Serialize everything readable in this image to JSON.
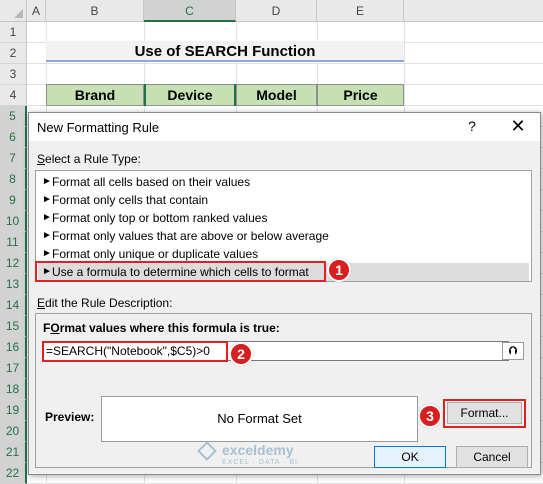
{
  "sheet": {
    "columns": [
      "A",
      "B",
      "C",
      "D",
      "E"
    ],
    "selected_column": "C",
    "rows": [
      "1",
      "2",
      "3",
      "4",
      "5",
      "6",
      "7",
      "8",
      "9",
      "10",
      "11",
      "12",
      "13",
      "14",
      "15",
      "16",
      "17",
      "18",
      "19",
      "20",
      "21",
      "22"
    ],
    "title": "Use of SEARCH Function",
    "table_headers": [
      "Brand",
      "Device",
      "Model",
      "Price"
    ]
  },
  "dialog": {
    "title": "New Formatting Rule",
    "help_symbol": "?",
    "close_symbol": "✕",
    "rule_type_label_ul": "S",
    "rule_type_label_rest": "elect a Rule Type:",
    "rule_types": [
      "Format all cells based on their values",
      "Format only cells that contain",
      "Format only top or bottom ranked values",
      "Format only values that are above or below average",
      "Format only unique or duplicate values",
      "Use a formula to determine which cells to format"
    ],
    "arrow_glyph": "►",
    "edit_label_ul": "E",
    "edit_label_rest": "dit the Rule Description:",
    "formula_label_ul": "O",
    "formula_label_pre": "F",
    "formula_label_rest": "rmat values where this formula is true:",
    "formula_value": "=SEARCH(\"Notebook\",$C5)>0",
    "collapse_symbol": "⮉",
    "preview_label": "Preview:",
    "preview_text": "No Format Set",
    "format_button": "Format...",
    "ok_button": "OK",
    "cancel_button": "Cancel"
  },
  "annotations": {
    "badge_1": "1",
    "badge_2": "2",
    "badge_3": "3",
    "color": "#d81f1f"
  },
  "watermark": {
    "name": "exceldemy",
    "tagline": "EXCEL · DATA · BI"
  }
}
